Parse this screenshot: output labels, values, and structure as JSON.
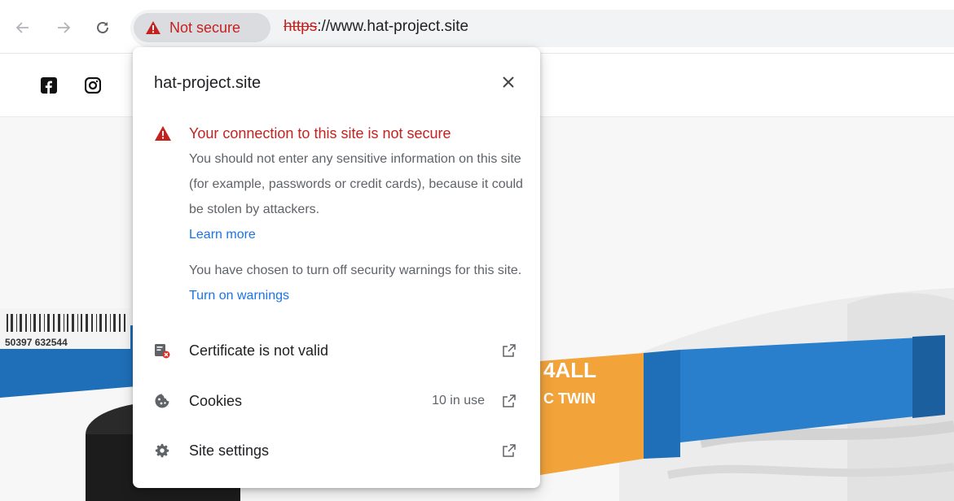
{
  "toolbar": {
    "security_chip_label": "Not secure",
    "url_scheme": "https",
    "url_rest": "://www.hat-project.site",
    "icons": [
      "back-arrow-icon",
      "forward-arrow-icon",
      "reload-icon",
      "warning-triangle-icon"
    ]
  },
  "page": {
    "social_icons": [
      "facebook-icon",
      "instagram-icon"
    ],
    "barcode_text": "50397 632544",
    "marker_brand": "4ALL",
    "marker_text": "C TWIN"
  },
  "popup": {
    "title": "hat-project.site",
    "warning_heading": "Your connection to this site is not secure",
    "warning_body": "You should not enter any sensitive information on this site (for example, passwords or credit cards), because it could be stolen by attackers.",
    "learn_more": "Learn more",
    "warnings_body": "You have chosen to turn off security warnings for this site.",
    "turn_on_warnings": "Turn on warnings",
    "rows": [
      {
        "label": "Certificate is not valid",
        "value": "",
        "icon": "certificate-invalid-icon"
      },
      {
        "label": "Cookies",
        "value": "10 in use",
        "icon": "cookie-icon"
      },
      {
        "label": "Site settings",
        "value": "",
        "icon": "gear-icon"
      }
    ]
  },
  "colors": {
    "danger": "#c5221f",
    "link": "#1a73e8",
    "chip_bg": "#dadce0",
    "omnibox_bg": "#f1f3f4"
  }
}
